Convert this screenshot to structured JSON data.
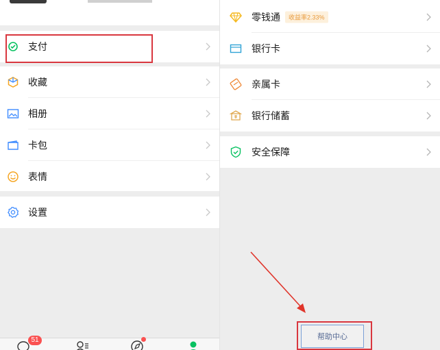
{
  "left_menu": {
    "pay_label": "支付",
    "favorites_label": "收藏",
    "album_label": "相册",
    "cards_label": "卡包",
    "stickers_label": "表情",
    "settings_label": "设置"
  },
  "tabbar": {
    "chats_badge": "51"
  },
  "wallet_menu": {
    "lingqiantong_label": "零钱通",
    "lingqiantong_yield": "收益率2.33%",
    "bank_card_label": "银行卡",
    "family_card_label": "亲属卡",
    "bank_savings_label": "银行储蓄",
    "security_label": "安全保障"
  },
  "help_center_label": "帮助中心",
  "colors": {
    "accent_green": "#07c160",
    "highlight_red": "#d9363e",
    "badge_red": "#fa5151",
    "link_blue": "#576b95"
  },
  "icons": [
    "pay-icon",
    "favorites-icon",
    "album-icon",
    "cards-icon",
    "stickers-icon",
    "settings-icon",
    "lingqiantong-icon",
    "bank-card-icon",
    "family-card-icon",
    "bank-savings-icon",
    "security-icon",
    "chats-tab-icon",
    "contacts-tab-icon",
    "discover-tab-icon",
    "me-tab-icon"
  ]
}
